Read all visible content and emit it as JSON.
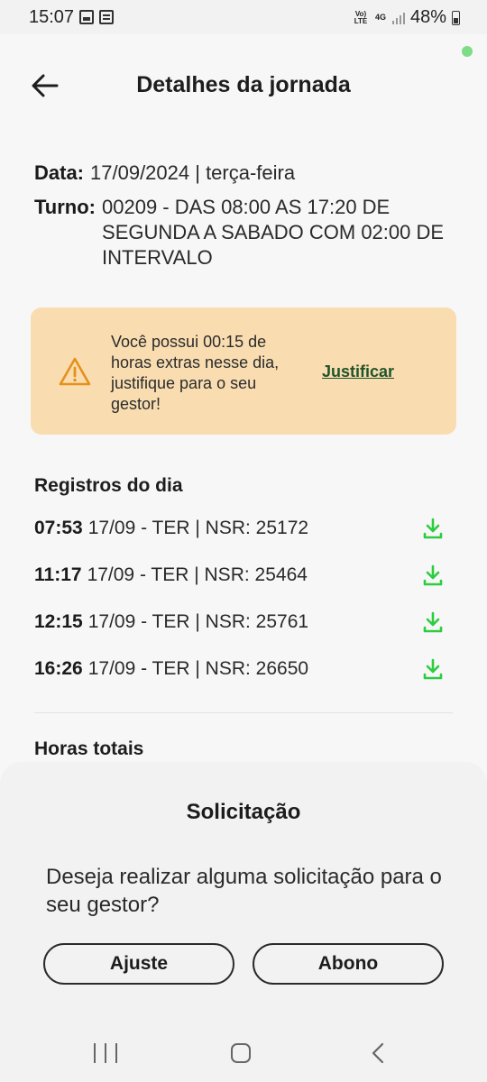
{
  "status_bar": {
    "time": "15:07",
    "icons_left": [
      "image-icon",
      "news-icon"
    ],
    "volte": "Vo) LTE",
    "network": "4G",
    "battery": "48%"
  },
  "header": {
    "title": "Detalhes da jornada",
    "back_icon": "arrow-left-icon"
  },
  "info": {
    "data_label": "Data:",
    "data_value": "17/09/2024 | terça-feira",
    "turno_label": "Turno:",
    "turno_value": "00209 - DAS 08:00 AS 17:20 DE SEGUNDA A SABADO COM 02:00 DE INTERVALO"
  },
  "alert": {
    "icon": "warning-icon",
    "text": "Você possui 00:15 de horas extras nesse dia, justifique para o seu gestor!",
    "link": "Justificar",
    "background": "#f9ddb1"
  },
  "records": {
    "title": "Registros do dia",
    "items": [
      {
        "time": "07:53",
        "detail": "17/09 - TER | NSR: 25172"
      },
      {
        "time": "11:17",
        "detail": "17/09 - TER | NSR: 25464"
      },
      {
        "time": "12:15",
        "detail": "17/09 - TER | NSR: 25761"
      },
      {
        "time": "16:26",
        "detail": "17/09 - TER | NSR: 26650"
      }
    ],
    "download_icon": "download-icon",
    "download_color": "#2ecc40"
  },
  "totals": {
    "title": "Horas totais"
  },
  "sheet": {
    "title": "Solicitação",
    "question": "Deseja realizar alguma solicitação para o seu gestor?",
    "btn_ajuste": "Ajuste",
    "btn_abono": "Abono"
  },
  "navbar": {
    "recents_icon": "recents-icon",
    "home_icon": "home-icon",
    "back_icon": "back-chevron-icon"
  }
}
